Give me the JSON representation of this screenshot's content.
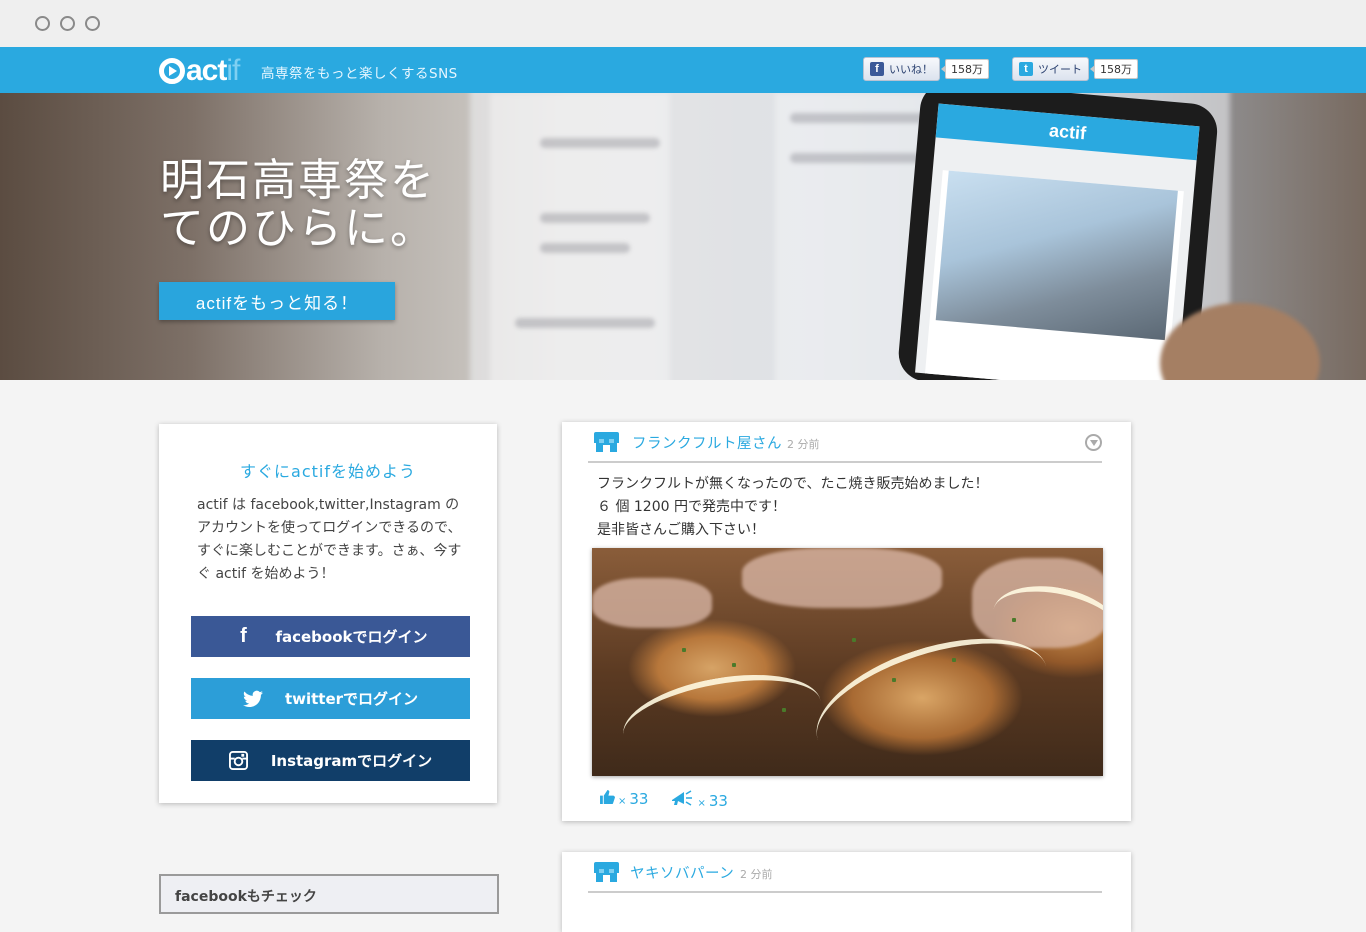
{
  "header": {
    "logo": {
      "main": "act",
      "accent": "if"
    },
    "tagline": "高専祭をもっと楽しくするSNS",
    "share": [
      {
        "label": "いいね！",
        "count": "158万",
        "icon": "facebook-icon",
        "color": "#3b5998"
      },
      {
        "label": "ツイート",
        "count": "158万",
        "icon": "twitter-icon",
        "color": "#2aa9e0"
      }
    ]
  },
  "hero": {
    "title_line1": "明石高専祭を",
    "title_line2": "てのひらに。",
    "cta": "actifをもっと知る！",
    "phone_app_name": "actif"
  },
  "start": {
    "title": "すぐにactifを始めよう",
    "text": "actif は facebook,twitter,Instagram のアカウントを使ってログインできるので、すぐに楽しむことができます。さぁ、今すぐ actif を始めよう！",
    "buttons": [
      {
        "label": "facebookでログイン",
        "icon": "facebook-icon",
        "color": "#3a5896"
      },
      {
        "label": "twitterでログイン",
        "icon": "twitter-icon",
        "color": "#2c9ed8"
      },
      {
        "label": "Instagramでログイン",
        "icon": "instagram-icon",
        "color": "#113e69"
      }
    ],
    "facebook_check": "facebookもチェック"
  },
  "posts": [
    {
      "name": "フランクフルト屋さん",
      "time": "2 分前",
      "body": [
        "フランクフルトが無くなったので、たこ焼き販売始めました！",
        "６ 個 1200 円で発売中です！",
        "是非皆さんご購入下さい！"
      ],
      "likes": "33",
      "cheers": "33",
      "x": "×"
    },
    {
      "name": "ヤキソバパーン",
      "time": "2 分前"
    }
  ],
  "colors": {
    "accent": "#2aa9e0",
    "facebook": "#3a5896",
    "twitter": "#2c9ed8",
    "instagram": "#113e69"
  }
}
